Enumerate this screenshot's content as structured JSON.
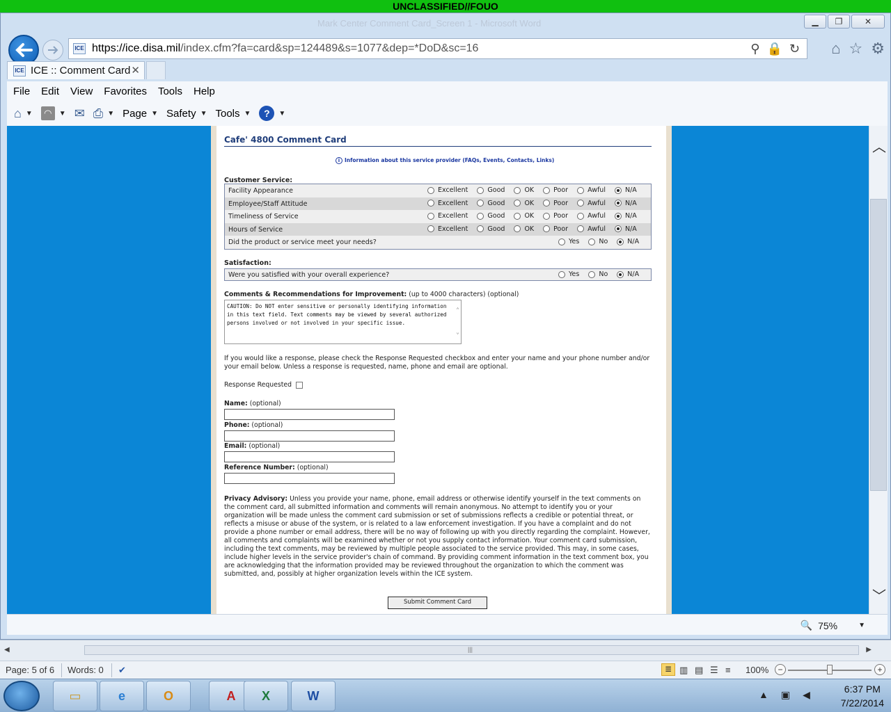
{
  "classification": "UNCLASSIFIED//FOUO",
  "window": {
    "ghost_title": "Mark Center Comment Card_Screen 1 - Microsoft Word"
  },
  "address_bar": {
    "url_host": "https://ice.disa.mil",
    "url_path": "/index.cfm?fa=card&sp=124489&s=1077&dep=*DoD&sc=16",
    "favicon_text": "ICE"
  },
  "tab": {
    "title": "ICE :: Comment Card",
    "close": "✕"
  },
  "menu": [
    "File",
    "Edit",
    "View",
    "Favorites",
    "Tools",
    "Help"
  ],
  "command_bar": {
    "page": "Page",
    "safety": "Safety",
    "tools": "Tools"
  },
  "form": {
    "title": "Cafe' 4800 Comment Card",
    "info_link": "Information about this service provider (FAQs, Events, Contacts, Links)",
    "customer_service_label": "Customer Service:",
    "rating_options": [
      "Excellent",
      "Good",
      "OK",
      "Poor",
      "Awful",
      "N/A"
    ],
    "rating_rows": [
      {
        "label": "Facility Appearance",
        "selected": "N/A"
      },
      {
        "label": "Employee/Staff Attitude",
        "selected": "N/A"
      },
      {
        "label": "Timeliness of Service",
        "selected": "N/A"
      },
      {
        "label": "Hours of Service",
        "selected": "N/A"
      }
    ],
    "needs_question": "Did the product or service meet your needs?",
    "yn_options": [
      "Yes",
      "No",
      "N/A"
    ],
    "satisfaction_label": "Satisfaction:",
    "satisfaction_question": "Were you satisfied with your overall experience?",
    "comments_label": "Comments & Recommendations for Improvement:",
    "comments_hint": " (up to 4000 characters) (optional)",
    "comments_text": "CAUTION:  Do NOT enter sensitive or personally identifying information in this text field.  Text comments may be viewed by several authorized persons involved or not involved in your specific issue.",
    "response_para": "If you would like a response, please check the Response Requested checkbox and enter your name and your phone number and/or your email below. Unless a response is requested, name, phone and email are optional.",
    "response_requested": "Response Requested",
    "name_label": "Name:",
    "phone_label": "Phone:",
    "email_label": "Email:",
    "ref_label": "Reference Number:",
    "optional": " (optional)",
    "privacy_label": "Privacy Advisory:",
    "privacy_text": " Unless you provide your name, phone, email address or otherwise identify yourself in the text comments on the comment card, all submitted information and comments will remain anonymous. No attempt to identify you or your organization will be made unless the comment card submission or set of submissions reflects a credible or potential threat, or reflects a misuse or abuse of the system, or is related to a law enforcement investigation. If you have a complaint and do not provide a phone number or email address, there will be no way of following up with you directly regarding the complaint. However, all comments and complaints will be examined whether or not you supply contact information. Your comment card submission, including the text comments, may be reviewed by multiple people associated to the service provided. This may, in some cases, include higher levels in the service provider's chain of command. By providing comment information in the text comment box, you are acknowledging that the information provided may be reviewed throughout the organization to which the comment was submitted, and, possibly at higher organization levels within the ICE system.",
    "submit_label": "Submit Comment Card"
  },
  "ie_status": {
    "zoom": "75%"
  },
  "word_status": {
    "page": "Page: 5 of 6",
    "words": "Words: 0",
    "zoom": "100%"
  },
  "taskbar": {
    "time": "6:37 PM",
    "date": "7/22/2014"
  },
  "colors": {
    "classification_bar": "#10c010",
    "page_background": "#0b86d6",
    "title_blue": "#1f3d7a"
  }
}
